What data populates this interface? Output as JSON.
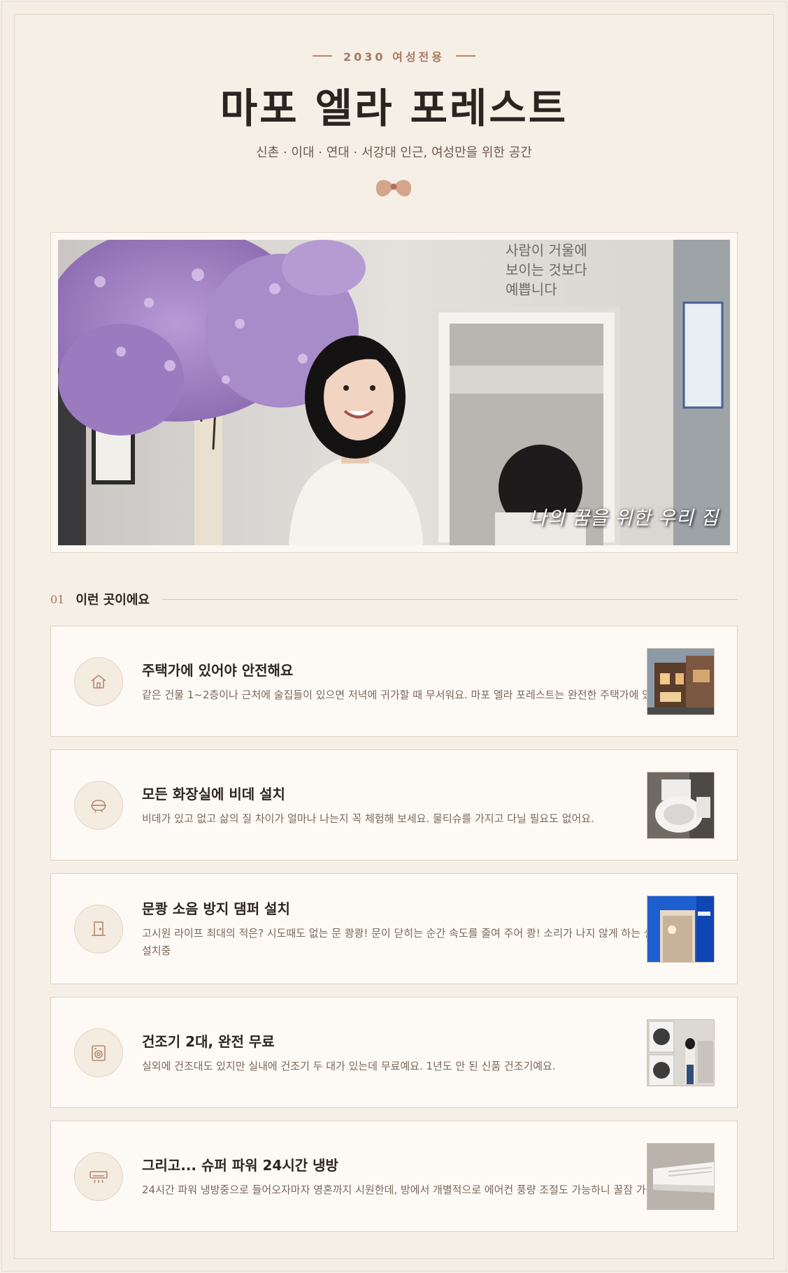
{
  "header": {
    "tag": "2030 여성전용",
    "title": "마포 엘라 포레스트",
    "subtitle": "신촌 · 이대 · 연대 · 서강대 인근, 여성만을 위한 공간"
  },
  "hero": {
    "caption": "나의 꿈을 위한 우리 집",
    "wall_text": [
      "사람이 거울에",
      "보이는 것보다",
      "예쁩니다"
    ]
  },
  "section": {
    "number": "01",
    "title": "이런 곳이에요"
  },
  "features": [
    {
      "icon": "house-icon",
      "title": "주택가에 있어야 안전해요",
      "desc": "같은 건물 1~2층이나 근처에 술집들이 있으면 저녁에 귀가할 때 무서워요. 마포 엘라 포레스트는 완전한 주택가에 있어요."
    },
    {
      "icon": "bidet-icon",
      "title": "모든 화장실에 비데 설치",
      "desc": "비데가 있고 없고 삶의 질 차이가 얼마나 나는지 꼭 체험해 보세요. 물티슈를 가지고 다닐 필요도 없어요."
    },
    {
      "icon": "door-icon",
      "title": "문쾅 소음 방지 댐퍼 설치",
      "desc": "고시원 라이프 최대의 적은? 시도때도 없는 문 쾅쾅! 문이 닫히는 순간 속도를 줄여 주어 쾅! 소리가 나지 않게 하는 설비를 설치중"
    },
    {
      "icon": "dryer-icon",
      "title": "건조기 2대, 완전 무료",
      "desc": "실외에 건조대도 있지만 실내에 건조기 두 대가 있는데 무료예요. 1년도 안 된 신품 건조기예요."
    },
    {
      "icon": "aircon-icon",
      "title": "그리고... 슈퍼 파워 24시간 냉방",
      "desc": "24시간 파워 냉방중으로 들어오자마자 영혼까지 시원한데, 방에서 개별적으로 에어컨 풍량 조절도 가능하니 꿀잠 가능."
    }
  ],
  "colors": {
    "background": "#f5eee5",
    "accent": "#a57860",
    "card": "#fdfaf5",
    "text": "#2d2520"
  }
}
